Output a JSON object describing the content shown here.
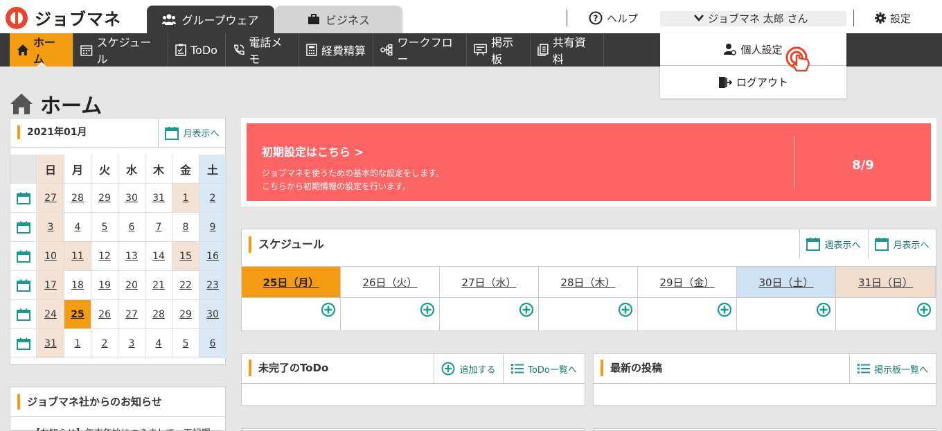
{
  "app": {
    "logo_text": "ジョブマネ",
    "brand_color": "#e8452c",
    "accent_color": "#f39c12",
    "link_color": "#157a6e"
  },
  "top_tabs": [
    {
      "label": "グループウェア",
      "icon": "group-icon",
      "active": true
    },
    {
      "label": "ビジネス",
      "icon": "briefcase-icon",
      "active": false
    }
  ],
  "header_right": {
    "help_label": "ヘルプ",
    "user_label": "ジョブマネ 太郎 さん",
    "settings_label": "設定"
  },
  "user_menu": {
    "items": [
      {
        "label": "個人設定",
        "icon": "user-gear-icon"
      },
      {
        "label": "ログアウト",
        "icon": "logout-icon"
      }
    ]
  },
  "nav": {
    "items": [
      {
        "label": "ホーム",
        "icon": "home-icon",
        "active": true
      },
      {
        "label": "スケジュール",
        "icon": "calendar-icon"
      },
      {
        "label": "ToDo",
        "icon": "checklist-icon"
      },
      {
        "label": "電話メモ",
        "icon": "phone-icon"
      },
      {
        "label": "経費精算",
        "icon": "calculator-icon"
      },
      {
        "label": "ワークフロー",
        "icon": "workflow-icon"
      },
      {
        "label": "掲示板",
        "icon": "board-icon"
      },
      {
        "label": "共有資料",
        "icon": "documents-icon"
      }
    ]
  },
  "page": {
    "title": "ホーム"
  },
  "calendar": {
    "title": "2021年01月",
    "month_view_label": "月表示へ",
    "weekdays": [
      "日",
      "月",
      "火",
      "水",
      "木",
      "金",
      "土"
    ],
    "weeks": [
      [
        "27",
        "28",
        "29",
        "30",
        "31",
        "1",
        "2"
      ],
      [
        "3",
        "4",
        "5",
        "6",
        "7",
        "8",
        "9"
      ],
      [
        "10",
        "11",
        "12",
        "13",
        "14",
        "15",
        "16"
      ],
      [
        "17",
        "18",
        "19",
        "20",
        "21",
        "22",
        "23"
      ],
      [
        "24",
        "25",
        "26",
        "27",
        "28",
        "29",
        "30"
      ],
      [
        "31",
        "1",
        "2",
        "3",
        "4",
        "5",
        "6"
      ]
    ],
    "today": "25",
    "holidays": [
      "1",
      "11",
      "15"
    ]
  },
  "notice": {
    "title": "ジョブマネ社からのお知らせ",
    "first_line": "【お知らせ】年末年始につきまして、下記期"
  },
  "setup_banner": {
    "title": "初期設定はこちら >",
    "desc_line1": "ジョブマネを使うための基本的な設定をします。",
    "desc_line2": "こちらから初期情報の設定を行います。",
    "progress": "8/9",
    "color": "#fe6464"
  },
  "schedule": {
    "title": "スケジュール",
    "week_view_label": "週表示へ",
    "month_view_label": "月表示へ",
    "days": [
      {
        "label": "25日（月）",
        "type": "today"
      },
      {
        "label": "26日（火）",
        "type": "weekday"
      },
      {
        "label": "27日（水）",
        "type": "weekday"
      },
      {
        "label": "28日（木）",
        "type": "weekday"
      },
      {
        "label": "29日（金）",
        "type": "weekday"
      },
      {
        "label": "30日（土）",
        "type": "sat"
      },
      {
        "label": "31日（日）",
        "type": "sun"
      }
    ]
  },
  "todo": {
    "title": "未完了のToDo",
    "add_label": "追加する",
    "list_label": "ToDo一覧へ"
  },
  "posts": {
    "title": "最新の投稿",
    "board_label": "掲示板一覧へ"
  }
}
